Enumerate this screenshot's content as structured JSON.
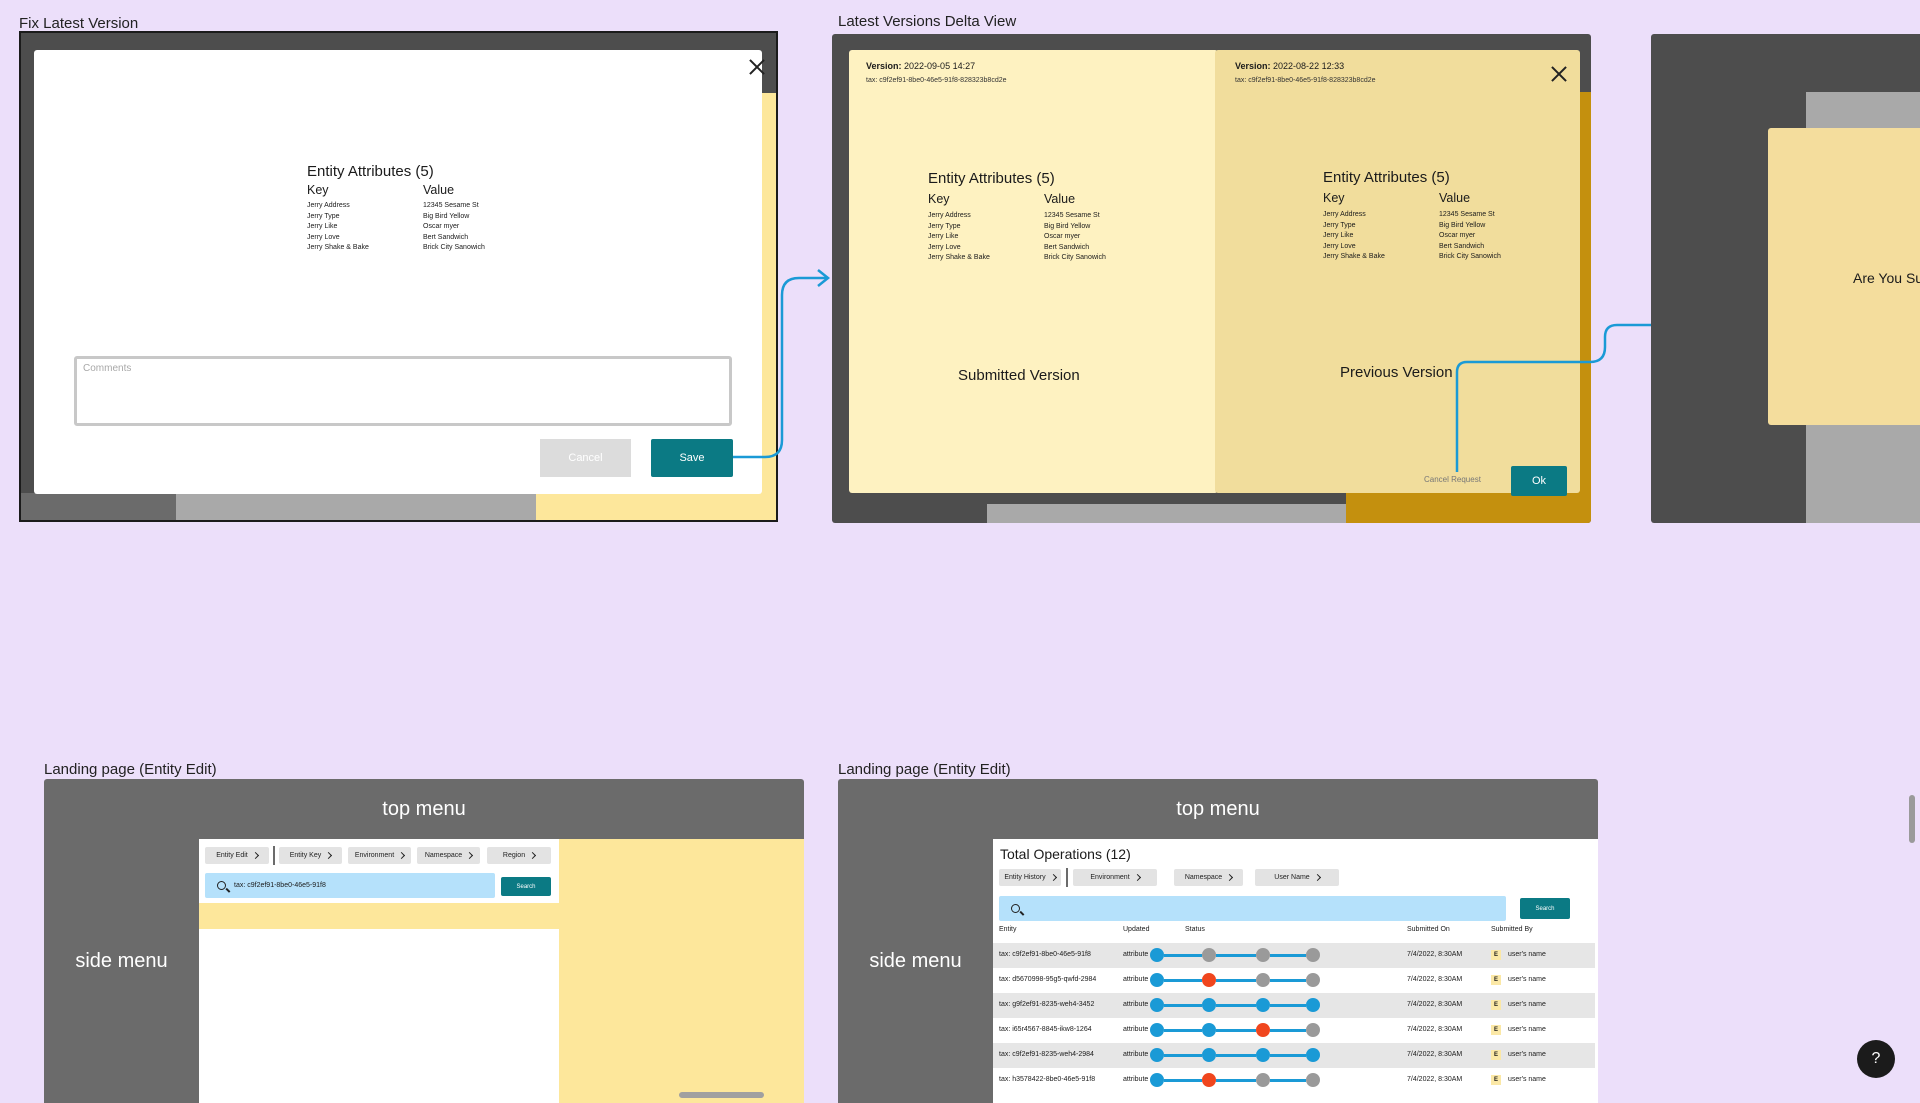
{
  "frames": {
    "fix_latest": {
      "label": "Fix Latest Version",
      "attributes_title": "Entity Attributes (5)",
      "key_header": "Key",
      "value_header": "Value",
      "keys": [
        "Jerry Address",
        "Jerry Type",
        "Jerry Like",
        "Jerry Love",
        "Jerry Shake & Bake"
      ],
      "values": [
        "12345 Sesame St",
        "Big Bird Yellow",
        "Oscar myer",
        "Bert Sandwich",
        "Brick City Sanowich"
      ],
      "comments_placeholder": "Comments",
      "cancel_label": "Cancel",
      "save_label": "Save"
    },
    "delta_view": {
      "label": "Latest Versions Delta View",
      "left": {
        "version_prefix": "Version:",
        "version_value": "2022-09-05 14:27",
        "tax": "tax: c9f2ef91-8be0-46e5-91f8-828323b8cd2e",
        "attributes_title": "Entity Attributes (5)",
        "key_header": "Key",
        "value_header": "Value",
        "keys": [
          "Jerry Address",
          "Jerry Type",
          "Jerry Like",
          "Jerry Love",
          "Jerry Shake & Bake"
        ],
        "values": [
          "12345 Sesame St",
          "Big Bird Yellow",
          "Oscar myer",
          "Bert Sandwich",
          "Brick City Sanowich"
        ],
        "caption": "Submitted Version"
      },
      "right": {
        "version_prefix": "Version:",
        "version_value": "2022-08-22 12:33",
        "tax": "tax: c9f2ef91-8be0-46e5-91f8-828323b8cd2e",
        "attributes_title": "Entity Attributes (5)",
        "key_header": "Key",
        "value_header": "Value",
        "keys": [
          "Jerry Address",
          "Jerry Type",
          "Jerry Like",
          "Jerry Love",
          "Jerry Shake & Bake"
        ],
        "values": [
          "12345 Sesame St",
          "Big Bird Yellow",
          "Oscar myer",
          "Bert Sandwich",
          "Brick City Sanowich"
        ],
        "caption": "Previous Version",
        "cancel_request_label": "Cancel Request",
        "ok_label": "Ok"
      }
    },
    "confirm": {
      "text": "Are You Su"
    },
    "landing1": {
      "label": "Landing page (Entity Edit)",
      "top_menu": "top menu",
      "side_menu": "side menu",
      "crumbs": [
        "Entity Edit",
        "Entity Key",
        "Environment",
        "Namespace",
        "Region"
      ],
      "search_value": "tax: c9f2ef91-8be0-46e5-91f8",
      "search_button": "Search"
    },
    "landing2": {
      "label": "Landing page (Entity Edit)",
      "top_menu": "top menu",
      "side_menu": "side menu",
      "ops_title": "Total Operations (12)",
      "crumbs": [
        "Entity History",
        "Environment",
        "Namespace",
        "User Name"
      ],
      "search_button": "Search",
      "columns": [
        "Entity",
        "Updated",
        "Status",
        "Submitted On",
        "Submitted By"
      ],
      "rows": [
        {
          "entity": "tax: c9f2ef91-8be0-46e5-91f8",
          "updated": "attribute",
          "status": [
            "done",
            "pending",
            "pending",
            "pending"
          ],
          "submitted_on": "7/4/2022, 8:30AM",
          "avatar": "E",
          "submitted_by": "user's name"
        },
        {
          "entity": "tax: d5670998-95g5-qwfd-2984",
          "updated": "attribute",
          "status": [
            "done",
            "error",
            "pending",
            "pending"
          ],
          "submitted_on": "7/4/2022, 8:30AM",
          "avatar": "E",
          "submitted_by": "user's name"
        },
        {
          "entity": "tax: g9f2ef91-8235-weh4-3452",
          "updated": "attribute",
          "status": [
            "done",
            "done",
            "done",
            "done"
          ],
          "submitted_on": "7/4/2022, 8:30AM",
          "avatar": "E",
          "submitted_by": "user's name"
        },
        {
          "entity": "tax: i65r4567-8845-ikw8-1264",
          "updated": "attribute",
          "status": [
            "done",
            "done",
            "error",
            "pending"
          ],
          "submitted_on": "7/4/2022, 8:30AM",
          "avatar": "E",
          "submitted_by": "user's name"
        },
        {
          "entity": "tax: c9f2ef91-8235-weh4-2984",
          "updated": "attribute",
          "status": [
            "done",
            "done",
            "done",
            "done"
          ],
          "submitted_on": "7/4/2022, 8:30AM",
          "avatar": "E",
          "submitted_by": "user's name"
        },
        {
          "entity": "tax: h3578422-8be0-46e5-91f8",
          "updated": "attribute",
          "status": [
            "done",
            "error",
            "pending",
            "pending"
          ],
          "submitted_on": "7/4/2022, 8:30AM",
          "avatar": "E",
          "submitted_by": "user's name"
        }
      ]
    }
  },
  "help_button": "?",
  "colors": {
    "canvas": "#ecdffa",
    "teal": "#0b7a84",
    "connector": "#1a9ad6",
    "status_done": "#1a9ad6",
    "status_error": "#f0461e",
    "status_pending": "#9a9a9a"
  }
}
